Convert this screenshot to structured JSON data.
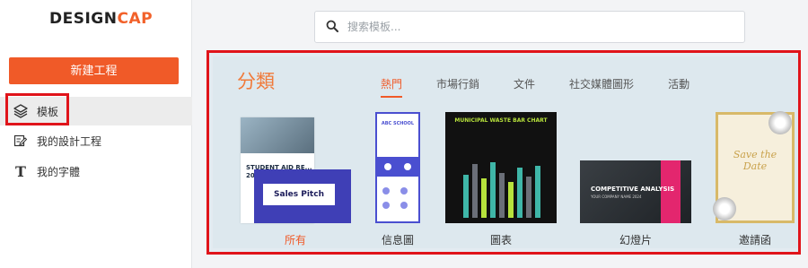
{
  "brand": {
    "part1": "DESIGN",
    "part2": "CAP",
    "accent_color": "#f2612a"
  },
  "sidebar": {
    "new_button_label": "新建工程",
    "items": [
      {
        "label": "模板",
        "icon": "layers-icon",
        "active": true
      },
      {
        "label": "我的設計工程",
        "icon": "edit-icon",
        "active": false
      },
      {
        "label": "我的字體",
        "icon": "text-icon",
        "active": false
      }
    ]
  },
  "search": {
    "placeholder": "搜索模板..."
  },
  "panel": {
    "title": "分類",
    "tabs": [
      {
        "label": "熱門",
        "active": true
      },
      {
        "label": "市場行銷",
        "active": false
      },
      {
        "label": "文件",
        "active": false
      },
      {
        "label": "社交媒體圖形",
        "active": false
      },
      {
        "label": "活動",
        "active": false
      }
    ],
    "categories": [
      {
        "label": "所有",
        "active": true
      },
      {
        "label": "信息圖",
        "active": false
      },
      {
        "label": "圖表",
        "active": false
      },
      {
        "label": "幻燈片",
        "active": false
      },
      {
        "label": "邀請函",
        "active": false
      }
    ],
    "thumbnails": {
      "all_back_text": "STUDENT AID RE... 202...",
      "all_front_text": "Sales Pitch",
      "info_header": "ABC SCHOOL",
      "chart_title": "MUNICIPAL WASTE BAR CHART",
      "slide_title": "COMPETITIVE ANALYSIS",
      "slide_sub": "YOUR COMPANY NAME 2024",
      "invite_title_1": "Save the",
      "invite_title_2": "Date"
    }
  },
  "colors": {
    "highlight_box": "#e0141a",
    "active_tab": "#f05a28",
    "title": "#f07a3a"
  }
}
